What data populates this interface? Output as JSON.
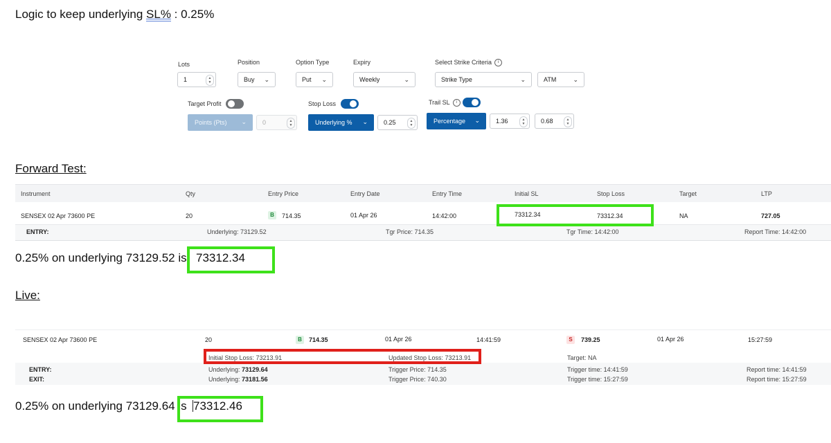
{
  "doc": {
    "title_prefix": "Logic to keep underlying ",
    "title_ul": "SL%",
    "title_suffix": " : 0.25%",
    "forward_heading": "Forward Test:",
    "live_heading": "Live:",
    "note1": "0.25% on underlying 73129.52 is",
    "note1_value": "73312.34",
    "note2": "0.25% on underlying 73129.64 is",
    "note2_value": "73312.46"
  },
  "settings": {
    "lots_label": "Lots",
    "lots_value": "1",
    "position_label": "Position",
    "position_value": "Buy",
    "option_type_label": "Option Type",
    "option_type_value": "Put",
    "expiry_label": "Expiry",
    "expiry_value": "Weekly",
    "strike_criteria_label": "Select Strike Criteria",
    "strike_type_value": "Strike Type",
    "strike_value": "ATM",
    "target_profit_label": "Target Profit",
    "target_profit_mode": "Points (Pts)",
    "target_profit_value": "0",
    "stop_loss_label": "Stop Loss",
    "stop_loss_mode": "Underlying %",
    "stop_loss_value": "0.25",
    "trail_sl_label": "Trail SL",
    "trail_mode": "Percentage",
    "trail_value1": "1.36",
    "trail_value2": "0.68",
    "toggle_target_on": false,
    "toggle_stop_loss_on": true,
    "toggle_trail_on": true,
    "accent_color": "#0d5ea8"
  },
  "forward": {
    "headers": [
      "Instrument",
      "Qty",
      "Entry Price",
      "Entry Date",
      "Entry Time",
      "Initial SL",
      "Stop Loss",
      "Target",
      "LTP"
    ],
    "row": {
      "instrument": "SENSEX 02 Apr 73600 PE",
      "qty": "20",
      "side": "B",
      "entry_price": "714.35",
      "entry_date": "01 Apr 26",
      "entry_time": "14:42:00",
      "initial_sl": "73312.34",
      "stop_loss": "73312.34",
      "target": "NA",
      "ltp": "727.05"
    },
    "entry": {
      "label": "ENTRY:",
      "underlying_label": "Underlying:",
      "underlying": "73129.52",
      "tgr_price_label": "Tgr Price:",
      "tgr_price": "714.35",
      "tgr_time_label": "Tgr Time:",
      "tgr_time": "14:42:00",
      "report_time_label": "Report Time:",
      "report_time": "14:42:00"
    }
  },
  "live": {
    "instrument": "SENSEX 02 Apr 73600 PE",
    "qty": "20",
    "buy_side": "B",
    "entry_price": "714.35",
    "entry_date": "01 Apr 26",
    "entry_time": "14:41:59",
    "sell_side": "S",
    "exit_price": "739.25",
    "exit_date": "01 Apr 26",
    "exit_time": "15:27:59",
    "initial_sl": "Initial Stop Loss: 73213.91",
    "updated_sl": "Updated Stop Loss: 73213.91",
    "target": "Target: NA",
    "entry_label": "ENTRY:",
    "exit_label": "EXIT:",
    "entry_underlying_label": "Underlying:",
    "entry_underlying": "73129.64",
    "exit_underlying_label": "Underlying:",
    "exit_underlying": "73181.56",
    "entry_trigger_price": "Trigger Price: 714.35",
    "exit_trigger_price": "Trigger Price: 740.30",
    "entry_trigger_time": "Trigger time: 14:41:59",
    "exit_trigger_time": "Trigger time: 15:27:59",
    "entry_report_time_label": "Report time:",
    "entry_report_time": "14:41:59",
    "exit_report_time_label": "Report time:",
    "exit_report_time": "15:27:59"
  },
  "colors": {
    "highlight_green": "#3ee11a",
    "highlight_red": "#e0201b",
    "buy_badge": "#1e8a3a",
    "sell_badge": "#c62828"
  }
}
